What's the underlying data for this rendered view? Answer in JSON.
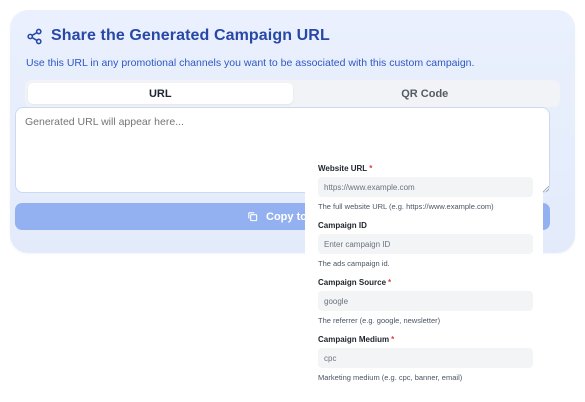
{
  "header": {
    "title": "Share the Generated Campaign URL",
    "subtitle": "Use this URL in any promotional channels you want to be associated with this custom campaign."
  },
  "tabs": [
    {
      "label": "URL",
      "active": true
    },
    {
      "label": "QR Code",
      "active": false
    }
  ],
  "output": {
    "placeholder": "Generated URL will appear here..."
  },
  "copy_button": {
    "label_visible": "Copy to C"
  },
  "form": {
    "website_url": {
      "label": "Website URL",
      "required_mark": "*",
      "placeholder": "https://www.example.com",
      "help": "The full website URL (e.g. https://www.example.com)"
    },
    "campaign_id": {
      "label": "Campaign ID",
      "placeholder": "Enter campaign ID",
      "help": "The ads campaign id."
    },
    "campaign_source": {
      "label": "Campaign Source",
      "required_mark": "*",
      "value": "google",
      "help": "The referrer (e.g. google, newsletter)"
    },
    "campaign_medium": {
      "label": "Campaign Medium",
      "required_mark": "*",
      "value": "cpc",
      "help": "Marketing medium (e.g. cpc, banner, email)"
    }
  },
  "colors": {
    "accent": "#2848a8",
    "copy_button_bg": "#93b1f1",
    "required": "#e23b3b"
  },
  "icons": [
    "share-icon",
    "copy-icon"
  ]
}
